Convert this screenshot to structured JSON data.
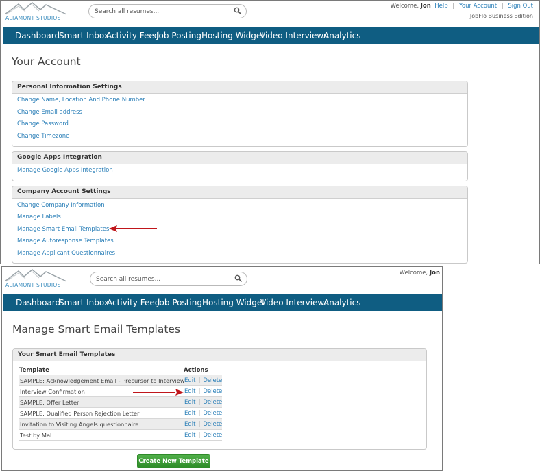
{
  "brand": {
    "logo_text": "ALTAMONT STUDIOS"
  },
  "search": {
    "placeholder": "Search all resumes..."
  },
  "header": {
    "welcome": "Welcome,",
    "user": "Jon",
    "links": {
      "help": "Help",
      "your_account": "Your Account",
      "sign_out": "Sign Out"
    },
    "separator": "|",
    "edition": "JobFlo Business Edition"
  },
  "nav": [
    "Dashboard",
    "Smart Inbox",
    "Activity Feed",
    "Job Posting",
    "Hosting Widget",
    "Video Interviews",
    "Analytics"
  ],
  "account_page": {
    "title": "Your Account",
    "sections": [
      {
        "heading": "Personal Information Settings",
        "links": [
          "Change Name, Location And Phone Number",
          "Change Email address",
          "Change Password",
          "Change Timezone"
        ]
      },
      {
        "heading": "Google Apps Integration",
        "links": [
          "Manage Google Apps Integration"
        ]
      },
      {
        "heading": "Company Account Settings",
        "links": [
          "Change Company Information",
          "Manage Labels",
          "Manage Smart Email Templates",
          "Manage Autoresponse Templates",
          "Manage Applicant Questionnaires"
        ]
      }
    ]
  },
  "templates_page": {
    "title": "Manage Smart Email Templates",
    "panel_heading": "Your Smart Email Templates",
    "columns": {
      "template": "Template",
      "actions": "Actions"
    },
    "actions": {
      "edit": "Edit",
      "delete": "Delete",
      "separator": "|"
    },
    "rows": [
      "SAMPLE: Acknowledgement Email - Precursor to Interview",
      "Interview Confirmation",
      "SAMPLE: Offer Letter",
      "SAMPLE: Qualified Person Rejection Letter",
      "Invitation to Visiting Angels questionnaire",
      "Test by Mal"
    ],
    "create_button": "Create New Template"
  },
  "colors": {
    "nav_bg": "#0f5d82",
    "link": "#2a7fb8",
    "button_green": "#3a9c33",
    "arrow_red": "#c0161b"
  }
}
